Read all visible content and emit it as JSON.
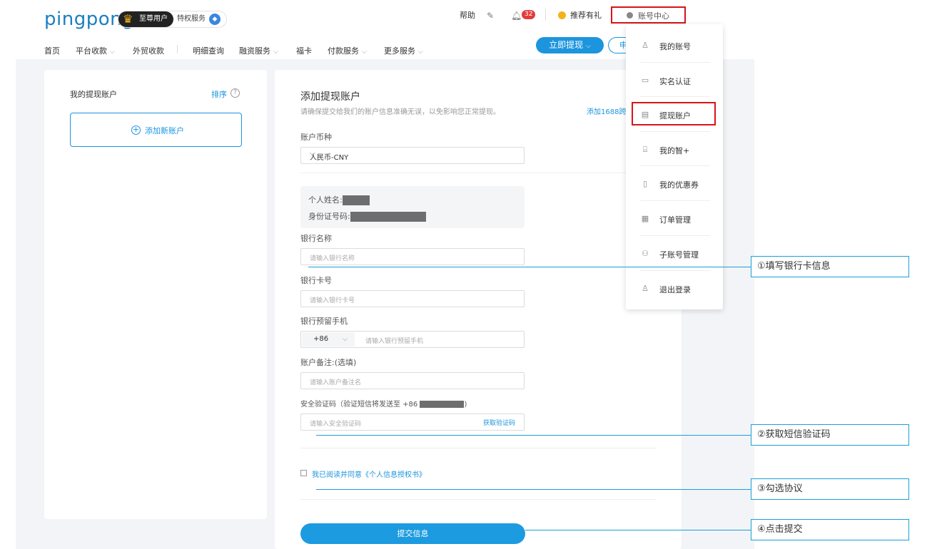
{
  "header": {
    "logo": "pingpong",
    "vip_label": "至尊用户",
    "privilege_label": "特权服务",
    "help": "帮助",
    "notification_count": "32",
    "referral": "推荐有礼",
    "account_center": "账号中心",
    "withdraw_button": "立即提现",
    "apply_button": "申"
  },
  "nav": {
    "items": [
      "首页",
      "平台收款",
      "外贸收款",
      "明细查询",
      "融资服务",
      "福卡",
      "付款服务",
      "更多服务"
    ]
  },
  "left_panel": {
    "title": "我的提现账户",
    "sort": "排序",
    "add_account": "添加新账户"
  },
  "form": {
    "title": "添加提现账户",
    "subtitle": "请确保提交给我们的账户信息准确无误，以免影响您正常提现。",
    "link": "添加1688跨",
    "currency_label": "账户币种",
    "currency_value": "人民币-CNY",
    "name_label": "个人姓名:",
    "id_label": "身份证号码:",
    "bank_name_label": "银行名称",
    "bank_name_placeholder": "请输入银行名称",
    "card_no_label": "银行卡号",
    "card_no_placeholder": "请输入银行卡号",
    "phone_label": "银行预留手机",
    "phone_prefix": "+86",
    "phone_placeholder": "请输入银行预留手机",
    "remark_label": "账户备注:(选填)",
    "remark_placeholder": "请输入账户备注名",
    "code_label": "安全验证码（验证短信将发送至 +86",
    "code_label_end": ")",
    "code_placeholder": "请输入安全验证码",
    "get_code": "获取验证码",
    "agree_text": "我已阅读并同意《个人信息授权书》",
    "submit": "提交信息"
  },
  "dropdown": {
    "items": [
      {
        "label": "我的账号",
        "icon": "user-icon"
      },
      {
        "label": "实名认证",
        "icon": "id-card-icon"
      },
      {
        "label": "提现账户",
        "icon": "bank-card-icon"
      },
      {
        "label": "我的智+",
        "icon": "gift-icon"
      },
      {
        "label": "我的优惠券",
        "icon": "coupon-icon"
      },
      {
        "label": "订单管理",
        "icon": "order-icon"
      },
      {
        "label": "子账号管理",
        "icon": "sub-account-icon"
      },
      {
        "label": "退出登录",
        "icon": "logout-icon"
      }
    ]
  },
  "annotations": {
    "step1": "①填写银行卡信息",
    "step2": "②获取短信验证码",
    "step3": "③勾选协议",
    "step4": "④点击提交"
  },
  "colors": {
    "primary": "#1c95dd",
    "highlight_red": "#d7141a",
    "annotation": "#1b9fd8"
  }
}
